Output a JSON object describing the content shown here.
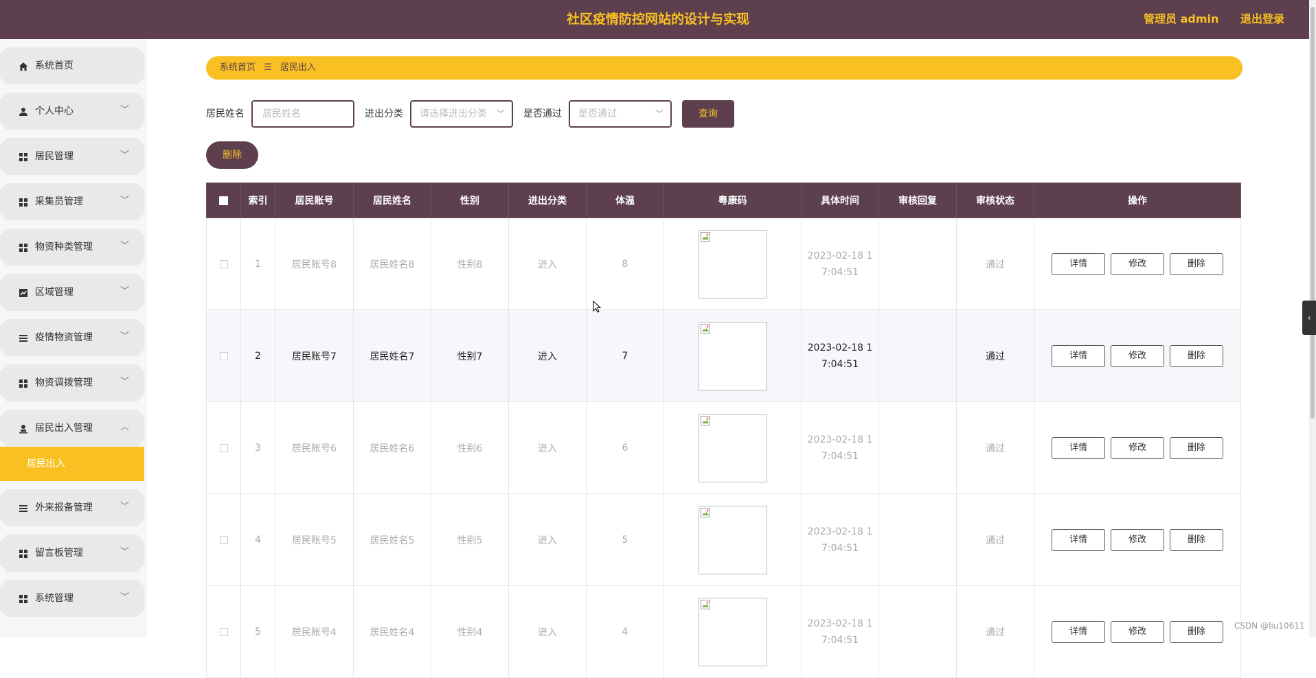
{
  "header": {
    "title": "社区疫情防控网站的设计与实现",
    "admin_label": "管理员 admin",
    "logout_label": "退出登录"
  },
  "sidebar": {
    "items": [
      {
        "label": "系统首页",
        "icon": "home-icon",
        "chevron": ""
      },
      {
        "label": "个人中心",
        "icon": "user-icon",
        "chevron": "﹀"
      },
      {
        "label": "居民管理",
        "icon": "grid-icon",
        "chevron": "﹀"
      },
      {
        "label": "采集员管理",
        "icon": "grid-icon",
        "chevron": "﹀"
      },
      {
        "label": "物资种类管理",
        "icon": "grid-icon",
        "chevron": "﹀"
      },
      {
        "label": "区域管理",
        "icon": "chart-icon",
        "chevron": "﹀"
      },
      {
        "label": "疫情物资管理",
        "icon": "list-icon",
        "chevron": "﹀"
      },
      {
        "label": "物资调拨管理",
        "icon": "grid-icon",
        "chevron": "﹀"
      },
      {
        "label": "居民出入管理",
        "icon": "user-stamp-icon",
        "chevron": "︿"
      },
      {
        "label": "外来报备管理",
        "icon": "list-icon",
        "chevron": "﹀"
      },
      {
        "label": "留言板管理",
        "icon": "grid-icon",
        "chevron": "﹀"
      },
      {
        "label": "系统管理",
        "icon": "grid-icon",
        "chevron": "﹀"
      }
    ],
    "active_submenu": "居民出入"
  },
  "breadcrumb": {
    "home": "系统首页",
    "separator": "☰",
    "current": "居民出入"
  },
  "search": {
    "name_label": "居民姓名",
    "name_placeholder": "居民姓名",
    "type_label": "进出分类",
    "type_placeholder": "请选择进出分类",
    "pass_label": "是否通过",
    "pass_placeholder": "是否通过",
    "query_button": "查询",
    "delete_button": "删除"
  },
  "table": {
    "headers": [
      "",
      "索引",
      "居民账号",
      "居民姓名",
      "性别",
      "进出分类",
      "体温",
      "粤康码",
      "具体时间",
      "审核回复",
      "审核状态",
      "操作"
    ],
    "rows": [
      {
        "index": "1",
        "account": "居民账号8",
        "name": "居民姓名8",
        "gender": "性别8",
        "direction": "进入",
        "temp": "8",
        "time1": "2023-02-18 1",
        "time2": "7:04:51",
        "reply": "",
        "status": "通过"
      },
      {
        "index": "2",
        "account": "居民账号7",
        "name": "居民姓名7",
        "gender": "性别7",
        "direction": "进入",
        "temp": "7",
        "time1": "2023-02-18 1",
        "time2": "7:04:51",
        "reply": "",
        "status": "通过"
      },
      {
        "index": "3",
        "account": "居民账号6",
        "name": "居民姓名6",
        "gender": "性别6",
        "direction": "进入",
        "temp": "6",
        "time1": "2023-02-18 1",
        "time2": "7:04:51",
        "reply": "",
        "status": "通过"
      },
      {
        "index": "4",
        "account": "居民账号5",
        "name": "居民姓名5",
        "gender": "性别5",
        "direction": "进入",
        "temp": "5",
        "time1": "2023-02-18 1",
        "time2": "7:04:51",
        "reply": "",
        "status": "通过"
      },
      {
        "index": "5",
        "account": "居民账号4",
        "name": "居民姓名4",
        "gender": "性别4",
        "direction": "进入",
        "temp": "4",
        "time1": "2023-02-18 1",
        "time2": "7:04:51",
        "reply": "",
        "status": "通过"
      }
    ],
    "actions": {
      "detail": "详情",
      "edit": "修改",
      "delete": "删除"
    }
  },
  "watermark": "CSDN @liu10611",
  "colors": {
    "primary": "#5d3f4e",
    "accent": "#f9c023"
  }
}
